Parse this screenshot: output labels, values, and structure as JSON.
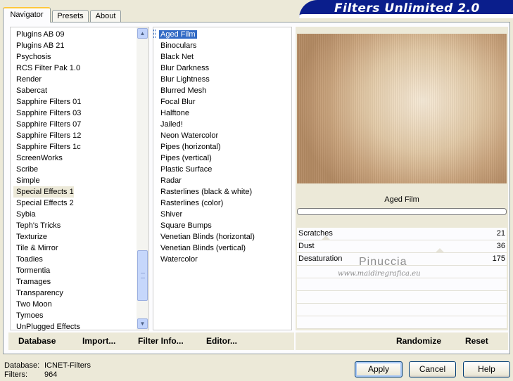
{
  "window": {
    "title": "Filters Unlimited 2.0"
  },
  "tabs": [
    {
      "label": "Navigator"
    },
    {
      "label": "Presets"
    },
    {
      "label": "About"
    }
  ],
  "categories": [
    "Plugins AB 09",
    "Plugins AB 21",
    "Psychosis",
    "RCS Filter Pak 1.0",
    "Render",
    "Sabercat",
    "Sapphire Filters 01",
    "Sapphire Filters 03",
    "Sapphire Filters 07",
    "Sapphire Filters 12",
    "Sapphire Filters 1c",
    "ScreenWorks",
    "Scribe",
    "Simple",
    "Special Effects 1",
    "Special Effects 2",
    "Sybia",
    "Teph's Tricks",
    "Texturize",
    "Tile & Mirror",
    "Toadies",
    "Tormentia",
    "Tramages",
    "Transparency",
    "Two Moon",
    "Tymoes",
    "UnPlugged Effects"
  ],
  "selected_category": "Special Effects 1",
  "filters": [
    "Aged Film",
    "Binoculars",
    "Black Net",
    "Blur Darkness",
    "Blur Lightness",
    "Blurred Mesh",
    "Focal Blur",
    "Halftone",
    "Jailed!",
    "Neon Watercolor",
    "Pipes (horizontal)",
    "Pipes (vertical)",
    "Plastic Surface",
    "Radar",
    "Rasterlines (black & white)",
    "Rasterlines (color)",
    "Shiver",
    "Square Bumps",
    "Venetian Blinds (horizontal)",
    "Venetian Blinds (vertical)",
    "Watercolor"
  ],
  "selected_filter": "Aged Film",
  "preview": {
    "filter_name": "Aged Film",
    "progress": 0
  },
  "params": [
    {
      "name": "Scratches",
      "value": "21"
    },
    {
      "name": "Dust",
      "value": "36"
    },
    {
      "name": "Desaturation",
      "value": "175"
    }
  ],
  "watermark": {
    "name": "Pinuccia",
    "url": "www.maidiregrafica.eu"
  },
  "toolbar": {
    "database": "Database",
    "import": "Import...",
    "filter_info": "Filter Info...",
    "editor": "Editor...",
    "randomize": "Randomize",
    "reset": "Reset"
  },
  "status": {
    "database_label": "Database:",
    "database_value": "ICNET-Filters",
    "filters_label": "Filters:",
    "filters_value": "964"
  },
  "buttons": {
    "apply": "Apply",
    "cancel": "Cancel",
    "help": "Help"
  },
  "scrollbar": {
    "up_icon": "▲",
    "down_icon": "▼"
  }
}
